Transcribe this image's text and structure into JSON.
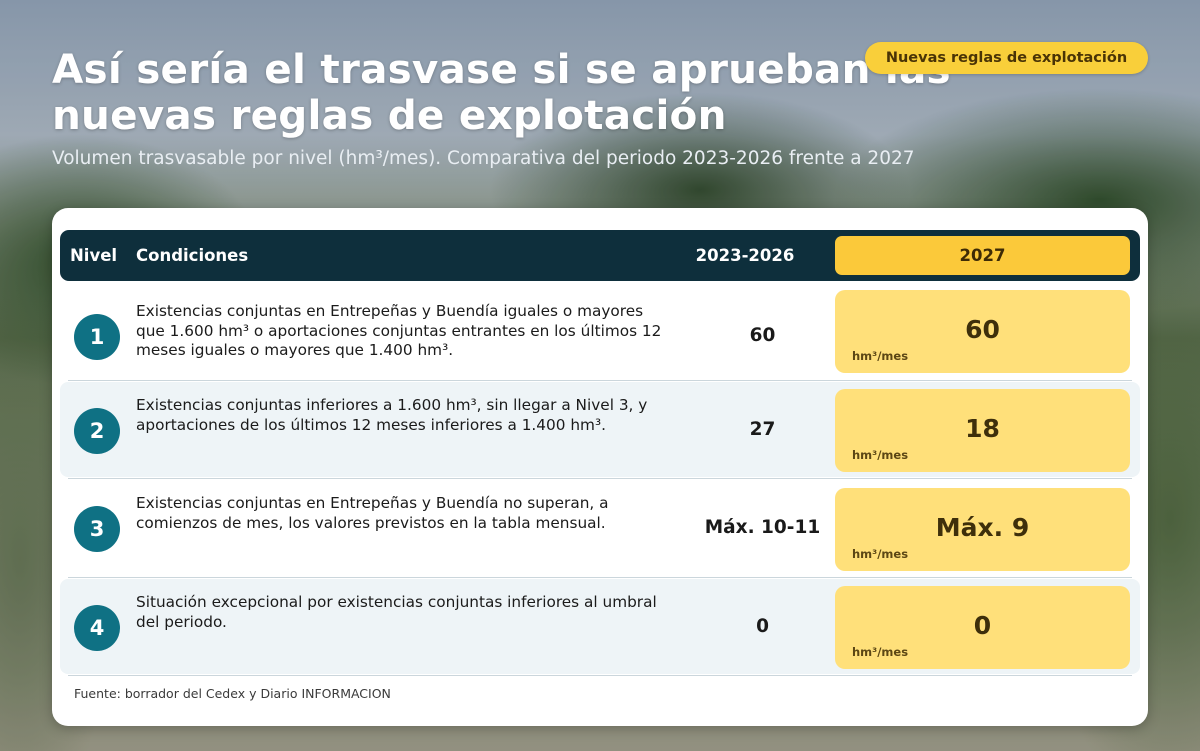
{
  "header": {
    "badge": "Nuevas reglas de explotación",
    "title": "Así sería el trasvase si se aprueban las nuevas reglas de explotación",
    "subtitle": "Volumen trasvasable por nivel (hm³/mes). Comparativa del periodo 2023-2026 frente a 2027"
  },
  "table": {
    "columns": {
      "nivel": "Nivel",
      "condiciones": "Condiciones",
      "period_a": "2023-2026",
      "period_b": "2027"
    },
    "rows": [
      {
        "level": "1",
        "condition": "Existencias conjuntas en Entrepeñas y Buendía iguales o mayores que 1.600 hm³ o aportaciones conjuntas entrantes en los últimos 12 meses iguales o mayores que 1.400 hm³.",
        "value_a": "60",
        "value_b": "60",
        "unit": "hm³/mes"
      },
      {
        "level": "2",
        "condition": "Existencias conjuntas inferiores a 1.600 hm³, sin llegar a Nivel 3, y aportaciones de los últimos 12 meses inferiores a 1.400 hm³.",
        "value_a": "27",
        "value_b": "18",
        "unit": "hm³/mes"
      },
      {
        "level": "3",
        "condition": "Existencias conjuntas en Entrepeñas y Buendía no superan, a comienzos de mes, los valores previstos en la tabla mensual.",
        "value_a": "Máx. 10-11",
        "value_b": "Máx. 9",
        "unit": "hm³/mes"
      },
      {
        "level": "4",
        "condition": "Situación excepcional por existencias conjuntas inferiores al umbral del periodo.",
        "value_a": "0",
        "value_b": "0",
        "unit": "hm³/mes"
      }
    ]
  },
  "footer": {
    "source": "Fuente: borrador del Cedex y Diario INFORMACION"
  },
  "colors": {
    "header_bg": "#0e2f3c",
    "accent_yellow": "#fbc93a",
    "cell_yellow": "#ffe07a",
    "level_circle": "#0f7184",
    "alt_row": "#eef4f7"
  }
}
